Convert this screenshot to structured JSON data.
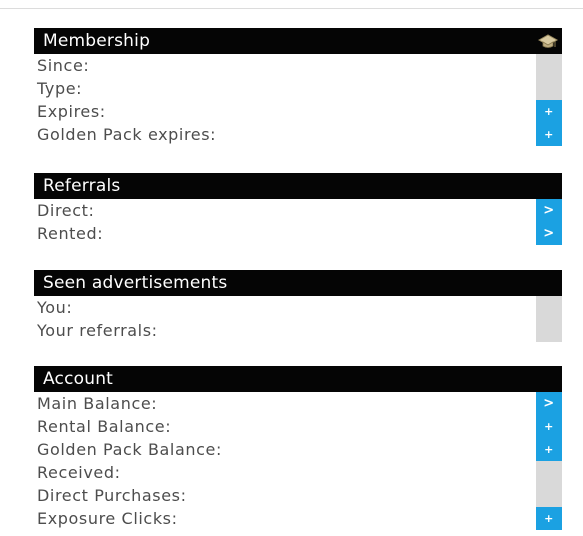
{
  "membership": {
    "title": "Membership",
    "icon": "graduation-cap-icon",
    "rows": [
      {
        "label": "Since:",
        "action": null
      },
      {
        "label": "Type:",
        "action": null
      },
      {
        "label": "Expires:",
        "action": "+"
      },
      {
        "label": "Golden Pack expires:",
        "action": "+"
      }
    ]
  },
  "referrals": {
    "title": "Referrals",
    "rows": [
      {
        "label": "Direct:",
        "action": ">"
      },
      {
        "label": "Rented:",
        "action": ">"
      }
    ]
  },
  "seen_ads": {
    "title": "Seen advertisements",
    "rows": [
      {
        "label": "You:",
        "action": null
      },
      {
        "label": "Your referrals:",
        "action": null
      }
    ]
  },
  "account": {
    "title": "Account",
    "rows": [
      {
        "label": "Main Balance:",
        "action": ">"
      },
      {
        "label": "Rental Balance:",
        "action": "+"
      },
      {
        "label": "Golden Pack Balance:",
        "action": "+"
      },
      {
        "label": "Received:",
        "action": null
      },
      {
        "label": "Direct Purchases:",
        "action": null
      },
      {
        "label": "Exposure Clicks:",
        "action": "+"
      }
    ]
  },
  "colors": {
    "header_bg": "#050505",
    "header_text": "#ffffff",
    "button_blue": "#1ba1e2",
    "strip_gray": "#d9d9d9",
    "label_gray": "#4d4d4d"
  }
}
